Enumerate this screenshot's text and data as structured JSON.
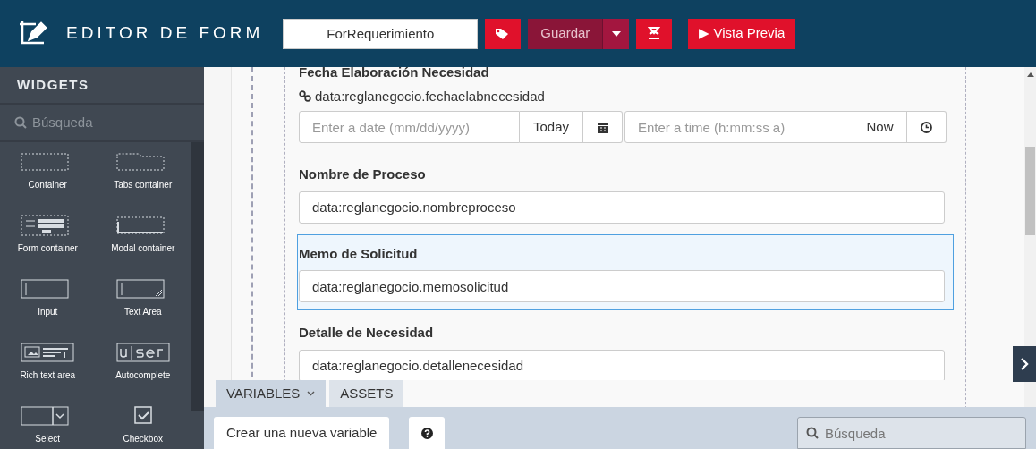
{
  "header": {
    "title": "EDITOR DE FORM",
    "form_name": "ForRequerimiento",
    "save_label": "Guardar",
    "preview_label": "▶ Vista Previa"
  },
  "sidebar": {
    "title": "WIDGETS",
    "search_placeholder": "Búsqueda",
    "widgets": [
      {
        "label": "Container",
        "kind": "container"
      },
      {
        "label": "Tabs container",
        "kind": "tabs"
      },
      {
        "label": "Form container",
        "kind": "form"
      },
      {
        "label": "Modal container",
        "kind": "modal"
      },
      {
        "label": "Input",
        "kind": "input"
      },
      {
        "label": "Text Area",
        "kind": "textarea"
      },
      {
        "label": "Rich text area",
        "kind": "rich"
      },
      {
        "label": "Autocomplete",
        "kind": "autocomplete"
      },
      {
        "label": "Select",
        "kind": "select"
      },
      {
        "label": "Checkbox",
        "kind": "checkbox"
      }
    ]
  },
  "fields": [
    {
      "kind": "datetime",
      "label": "Fecha Elaboración Necesidad",
      "binding": "data:reglanegocio.fechaelabnecesidad",
      "date_placeholder": "Enter a date (mm/dd/yyyy)",
      "today_label": "Today",
      "time_placeholder": "Enter a time (h:mm:ss a)",
      "now_label": "Now",
      "selected": false
    },
    {
      "kind": "text",
      "label": "Nombre de Proceso",
      "value": "data:reglanegocio.nombreproceso",
      "selected": false
    },
    {
      "kind": "text",
      "label": "Memo de Solicitud",
      "value": "data:reglanegocio.memosolicitud",
      "selected": true
    },
    {
      "kind": "text",
      "label": "Detalle de Necesidad",
      "value": "data:reglanegocio.detallenecesidad",
      "selected": false
    }
  ],
  "bottom_panel": {
    "tabs": [
      {
        "label": "VARIABLES",
        "selected": true
      },
      {
        "label": "ASSETS",
        "selected": false
      }
    ],
    "create_label": "Crear una nueva variable",
    "search_placeholder": "Búsqueda"
  }
}
